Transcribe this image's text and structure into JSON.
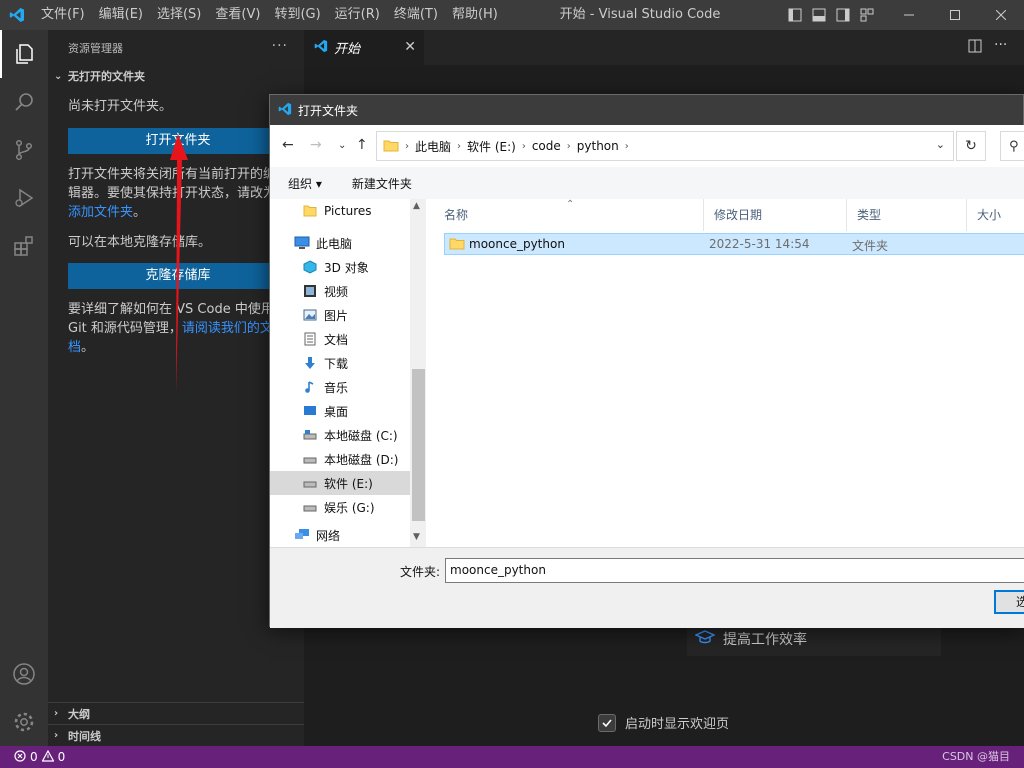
{
  "titlebar": {
    "title": "开始 - Visual Studio Code",
    "menu": [
      "文件(F)",
      "编辑(E)",
      "选择(S)",
      "查看(V)",
      "转到(G)",
      "运行(R)",
      "终端(T)",
      "帮助(H)"
    ]
  },
  "sidebar": {
    "header": "资源管理器",
    "more": "···",
    "section": "无打开的文件夹",
    "no_folder_text": "尚未打开文件夹。",
    "open_folder_button": "打开文件夹",
    "open_info_text": "打开文件夹将关闭所有当前打开的编辑器。要使其保持打开状态，请改为",
    "open_info_link": "添加文件夹",
    "open_info_end": "。",
    "clone_text": "可以在本地克隆存储库。",
    "clone_button": "克隆存储库",
    "git_text": "要详细了解如何在 VS Code 中使用 Git 和源代码管理，",
    "git_link": "请阅读我们的文档",
    "git_end": "。",
    "outline": "大纲",
    "timeline": "时间线"
  },
  "editor": {
    "tab_label": "开始",
    "walkthrough": "提高工作效率",
    "show_on_startup": "启动时显示欢迎页"
  },
  "statusbar": {
    "errors": "0",
    "warnings": "0",
    "watermark": "CSDN @猫目"
  },
  "dialog": {
    "title": "打开文件夹",
    "breadcrumbs": [
      "此电脑",
      "软件 (E:)",
      "code",
      "python"
    ],
    "toolbar": {
      "organize": "组织 ▾",
      "new_folder": "新建文件夹"
    },
    "nav_items": [
      {
        "label": "Pictures",
        "icon": "folder-icon"
      },
      {
        "label": "此电脑",
        "icon": "computer-icon"
      },
      {
        "label": "3D 对象",
        "icon": "cube-icon"
      },
      {
        "label": "视频",
        "icon": "video-icon"
      },
      {
        "label": "图片",
        "icon": "picture-icon"
      },
      {
        "label": "文档",
        "icon": "document-icon"
      },
      {
        "label": "下载",
        "icon": "download-icon"
      },
      {
        "label": "音乐",
        "icon": "music-icon"
      },
      {
        "label": "桌面",
        "icon": "desktop-icon"
      },
      {
        "label": "本地磁盘 (C:)",
        "icon": "drive-icon"
      },
      {
        "label": "本地磁盘 (D:)",
        "icon": "drive-icon"
      },
      {
        "label": "软件 (E:)",
        "icon": "drive-icon"
      },
      {
        "label": "娱乐 (G:)",
        "icon": "drive-icon"
      },
      {
        "label": "网络",
        "icon": "network-icon"
      }
    ],
    "columns": [
      "名称",
      "修改日期",
      "类型",
      "大小"
    ],
    "files": [
      {
        "name": "moonce_python",
        "date": "2022-5-31 14:54",
        "type": "文件夹",
        "size": ""
      }
    ],
    "filename_label": "文件夹:",
    "filename_value": "moonce_python",
    "select_button": "选"
  },
  "colors": {
    "accent": "#0e639c",
    "statusbar": "#68217a",
    "link": "#3794ff",
    "selection": "#cce8ff",
    "arrow": "#e8141b"
  }
}
